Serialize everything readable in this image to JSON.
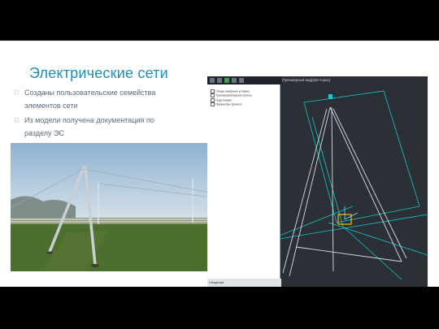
{
  "slide": {
    "title": "Электрические сети",
    "bullets": [
      "Созданы пользовательские семейства элементов сети",
      "Из модели получена документация по разделу ЭС"
    ]
  },
  "cad": {
    "view_title": "[Трёхмерный вид]{3D-торис}",
    "status_label": "Сведения",
    "tree_items": [
      "Опоры анкерные угловые",
      "Трансформаторные пункты",
      "Подстанции",
      "Параметры проекта"
    ]
  },
  "colors": {
    "title": "#1f8fb3",
    "cad_background": "#2b2f36",
    "wire_cyan": "#17c7c7",
    "selection_yellow": "#f2c200"
  }
}
